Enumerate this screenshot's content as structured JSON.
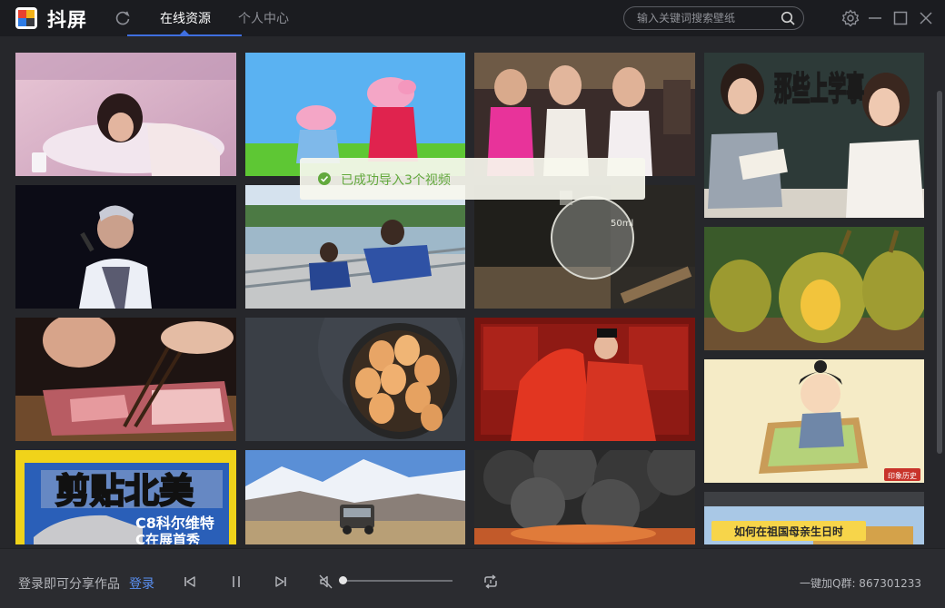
{
  "app": {
    "title": "抖屏"
  },
  "tabs": [
    {
      "label": "在线资源",
      "active": true
    },
    {
      "label": "个人中心",
      "active": false
    }
  ],
  "search": {
    "placeholder": "输入关键词搜索壁纸",
    "value": ""
  },
  "toast": {
    "message": "已成功导入3个视频"
  },
  "gallery": {
    "overlay_texts": {
      "school_title": "那些上学事",
      "car_title": "剪贴北美",
      "car_sub1": "C8科尔维特",
      "car_sub2": "C在展首秀",
      "beaker_label": "50ml",
      "cartoon_seal": "印象历史",
      "motherland_title": "如何在祖国母亲生日时"
    }
  },
  "footer": {
    "share_text": "登录即可分享作品",
    "login_label": "登录",
    "qq_text": "一键加Q群: 867301233",
    "volume": 0.0
  },
  "colors": {
    "accent": "#3f6fe0",
    "link": "#5a8ff0",
    "toast_text": "#62a93c"
  }
}
